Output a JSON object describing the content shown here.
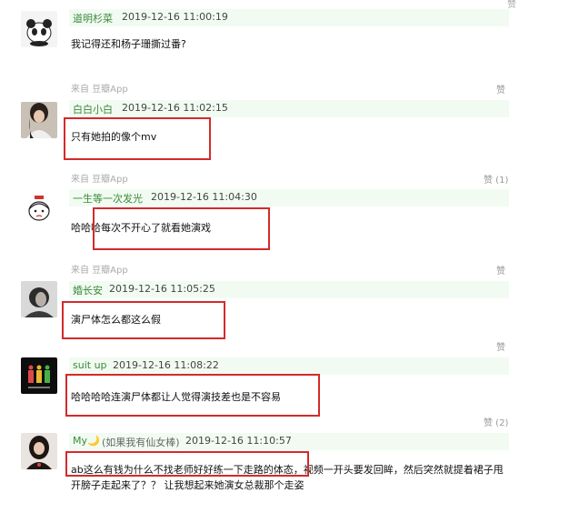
{
  "comments": [
    {
      "author": "道明杉菜",
      "time": "2019-12-16 11:00:19",
      "body": "我记得还和杨子珊撕过番?",
      "source": "来自 豆瓣App",
      "like": "赞"
    },
    {
      "author": "白白小白",
      "time": "2019-12-16 11:02:15",
      "body": "只有她拍的像个mv",
      "source": "来自 豆瓣App",
      "like": "赞 (1)"
    },
    {
      "author": "一生等一次发光",
      "time": "2019-12-16 11:04:30",
      "body": "哈哈哈每次不开心了就看她演戏",
      "source": "来自 豆瓣App",
      "like": "赞"
    },
    {
      "author": "婚长安",
      "time": "2019-12-16 11:05:25",
      "body": "演尸体怎么都这么假",
      "source": "",
      "like": "赞"
    },
    {
      "author": "suit up",
      "time": "2019-12-16 11:08:22",
      "body": "哈哈哈哈连演尸体都让人觉得演技差也是不容易",
      "source": "",
      "like": "赞 (2)"
    },
    {
      "author": "My🌙",
      "author_note": "(如果我有仙女棒)",
      "time": "2019-12-16 11:10:57",
      "body_line1": "ab这么有钱为什么不找老师好好练一下走路的体态，视频一开头要发回眸，然后突然就提着裙子甩",
      "body_line2": "开膀子走起来了？？ 让我想起来她演女总裁那个走姿"
    }
  ],
  "top_like": "赞",
  "colors": {
    "highlight_box": "#d42a2a",
    "author_link": "#3a8a3a",
    "header_bg": "#f2fbf2"
  }
}
